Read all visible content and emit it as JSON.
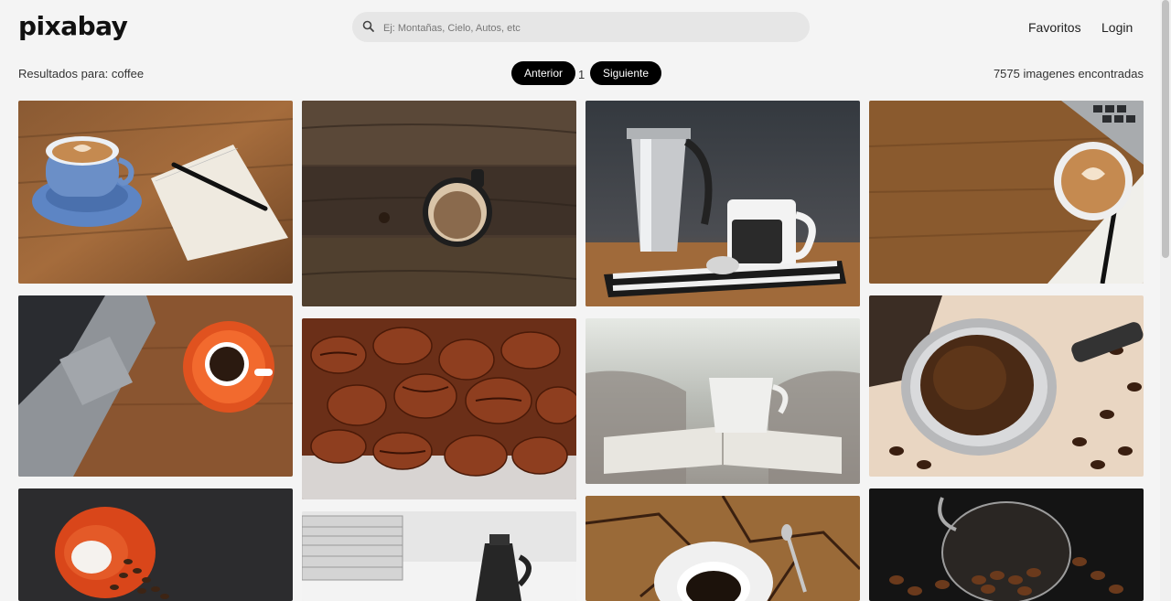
{
  "header": {
    "logo": "pixabay",
    "search_placeholder": "Ej: Montañas, Cielo, Autos, etc",
    "nav": {
      "favorites": "Favoritos",
      "login": "Login"
    }
  },
  "results": {
    "label": "Resultados para: coffee",
    "count": "7575 imagenes encontradas"
  },
  "pagination": {
    "prev_label": "Anterior",
    "page": "1",
    "next_label": "Siguiente"
  },
  "gallery": {
    "images": [
      {
        "name": "latte-art-notebook",
        "alt": "Latte with notebook and pen on wooden table"
      },
      {
        "name": "coffee-cup-dark-wood",
        "alt": "Coffee cup on dark wooden planks"
      },
      {
        "name": "moka-pot-coffee-mug",
        "alt": "Moka pot and coffee mug on striped cloth"
      },
      {
        "name": "latte-laptop-wood",
        "alt": "Latte next to laptop on wooden desk"
      },
      {
        "name": "laptop-orange-cup",
        "alt": "Laptop and orange coffee cup on table"
      },
      {
        "name": "coffee-beans-closeup",
        "alt": "Close-up of roasted coffee beans"
      },
      {
        "name": "cup-on-book",
        "alt": "White cup on open book"
      },
      {
        "name": "ground-coffee-portafilter",
        "alt": "Ground coffee in portafilter"
      },
      {
        "name": "orange-cup-spilled-beans",
        "alt": "Orange cup with spilled coffee beans"
      },
      {
        "name": "moka-pot-magazines",
        "alt": "Moka pot beside magazines"
      },
      {
        "name": "coffee-cup-cracked-wood",
        "alt": "Coffee cup on cracked wood"
      },
      {
        "name": "glass-cup-beans",
        "alt": "Glass cup with coffee beans"
      }
    ]
  }
}
